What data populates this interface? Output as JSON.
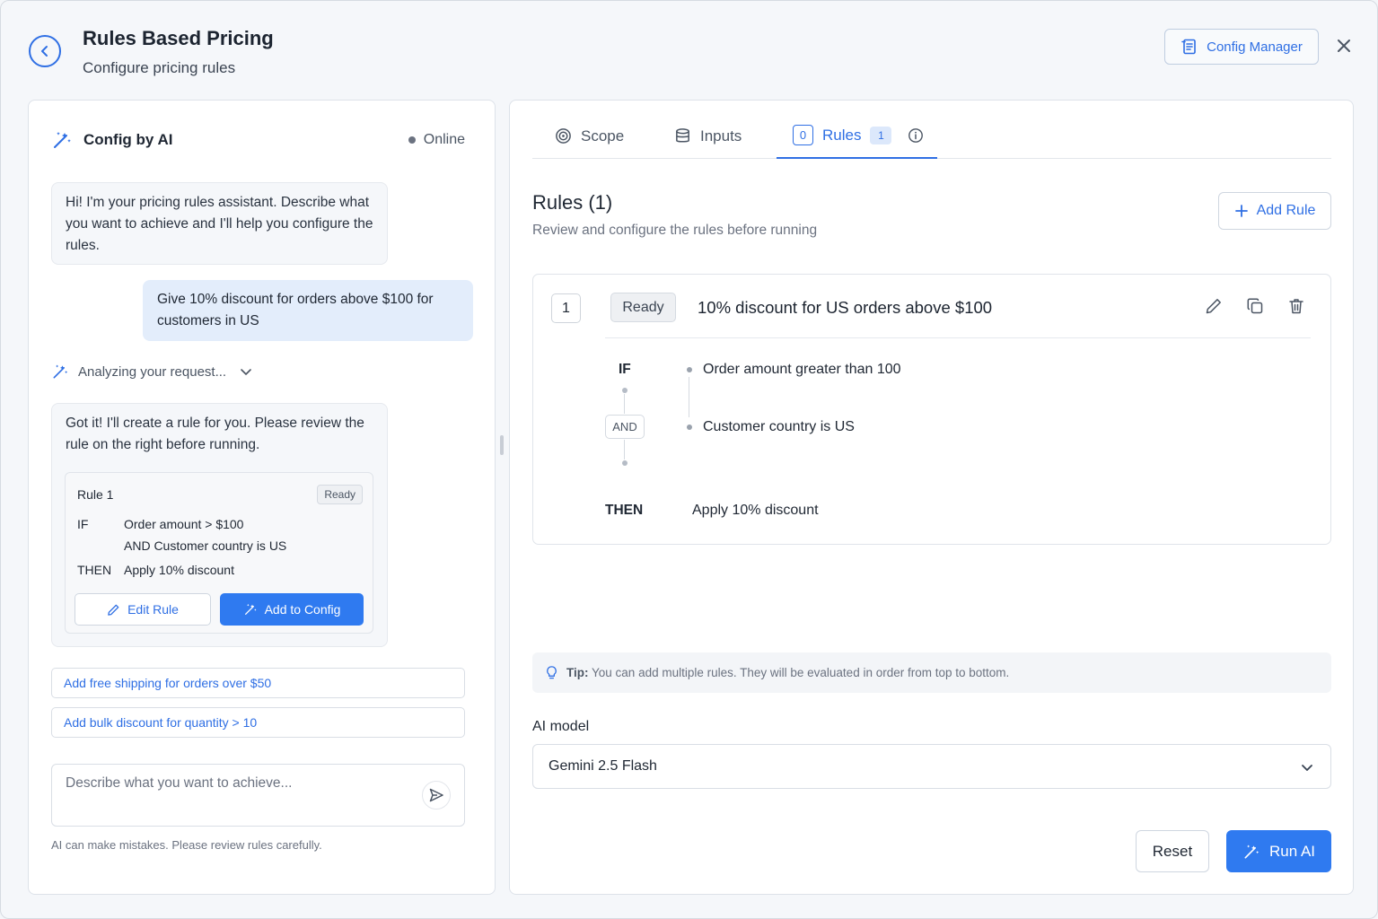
{
  "header": {
    "title": "Rules Based Pricing",
    "subtitle": "Configure pricing rules",
    "config_manager_label": "Config Manager"
  },
  "chat": {
    "title": "Config by AI",
    "status": "Online",
    "bot_intro": "Hi! I'm your pricing rules assistant. Describe what you want to achieve and I'll help you configure the rules.",
    "user_message": "Give 10% discount for orders above $100 for customers in US",
    "analyzing_label": "Analyzing your request...",
    "bot_reply": "Got it! I'll create a rule for you. Please review the rule on the right before running.",
    "rule_card": {
      "title": "Rule 1",
      "badge": "Ready",
      "if_label": "IF",
      "if_line1": "Order amount > $100",
      "if_line2": "AND Customer country is US",
      "then_label": "THEN",
      "then_text": "Apply 10% discount",
      "edit_label": "Edit Rule",
      "add_label": "Add to Config"
    },
    "suggestions": [
      "Add free shipping for orders over $50",
      "Add bulk discount for quantity > 10"
    ],
    "input_placeholder": "Describe what you want to achieve...",
    "disclaimer": "AI can make mistakes. Please review rules carefully."
  },
  "tabs": {
    "scope": "Scope",
    "inputs": "Inputs",
    "rules": "Rules",
    "rules_prefix_count": "0",
    "rules_count": "1"
  },
  "rules": {
    "title": "Rules (1)",
    "subtitle": "Review and configure the rules before running",
    "add_label": "Add Rule",
    "items": [
      {
        "number": "1",
        "status": "Ready",
        "name": "10% discount for US orders above $100",
        "if_label": "IF",
        "and_label": "AND",
        "then_label": "THEN",
        "condition1": "Order amount greater than 100",
        "condition2": "Customer country is US",
        "action": "Apply 10% discount"
      }
    ]
  },
  "tip": {
    "label": "Tip:",
    "text": "You can add multiple rules. They will be evaluated in order from top to bottom."
  },
  "model": {
    "label": "AI model",
    "selected": "Gemini 2.5 Flash"
  },
  "footer": {
    "reset_label": "Reset",
    "run_label": "Run AI"
  },
  "colors": {
    "accent": "#2f7af0",
    "link": "#2f6fe4",
    "user_bubble": "#e3edfb"
  }
}
